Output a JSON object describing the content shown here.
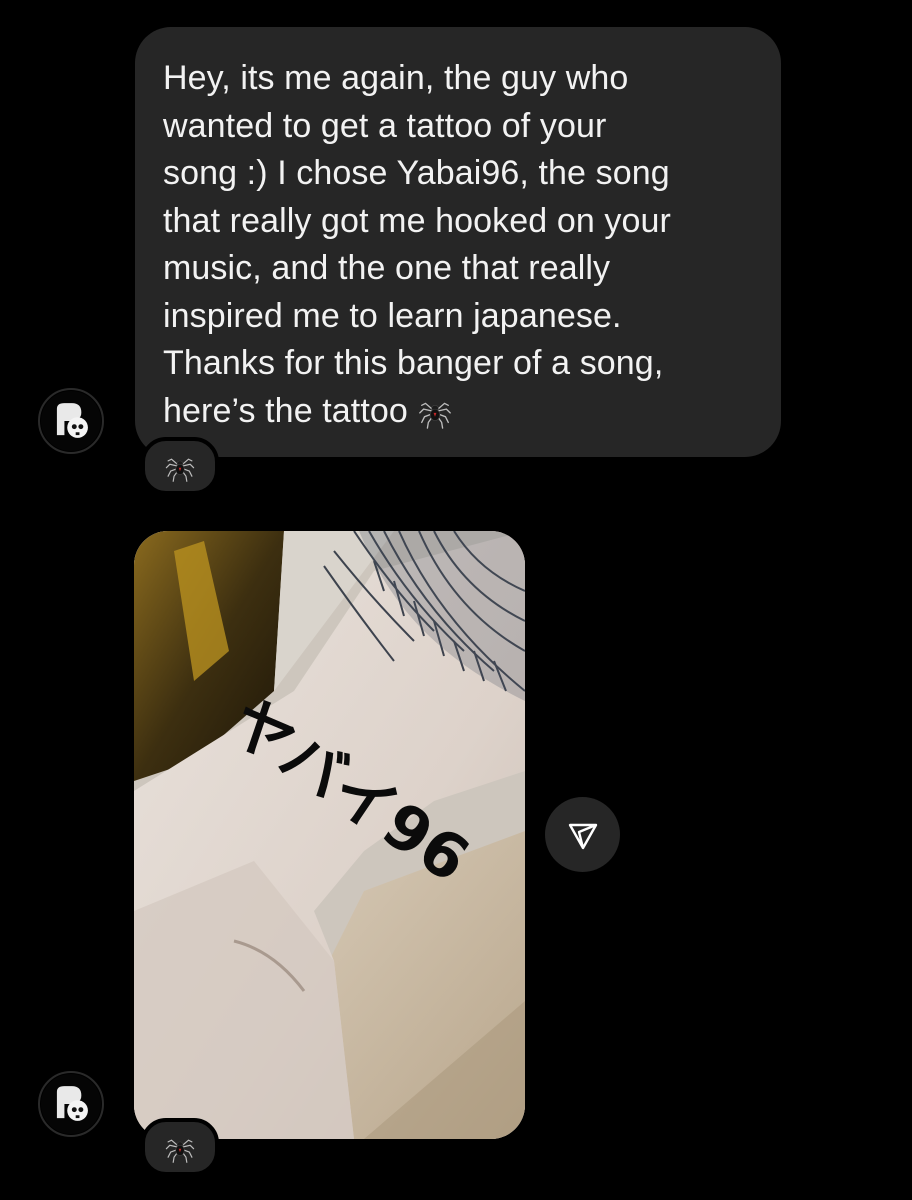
{
  "thread": {
    "message": {
      "text": "Hey, its me again, the guy who\nwanted to get a tattoo of your\nsong :) I chose Yabai96, the song\nthat really got me hooked on your\nmusic, and the one that really\ninspired me to learn japanese.\nThanks for this banger of a song,\nhere’s the tattoo",
      "inline_emoji": "spider-emoji",
      "reaction": "spider-emoji"
    },
    "photo_message": {
      "tattoo_text": "ヤバイ96",
      "reaction": "spider-emoji"
    },
    "share_button_icon": "paper-plane-icon",
    "avatar_icon": "skull-avatar-icon"
  },
  "colors": {
    "background": "#000000",
    "bubble": "#262626",
    "text": "#f2f2f2"
  }
}
